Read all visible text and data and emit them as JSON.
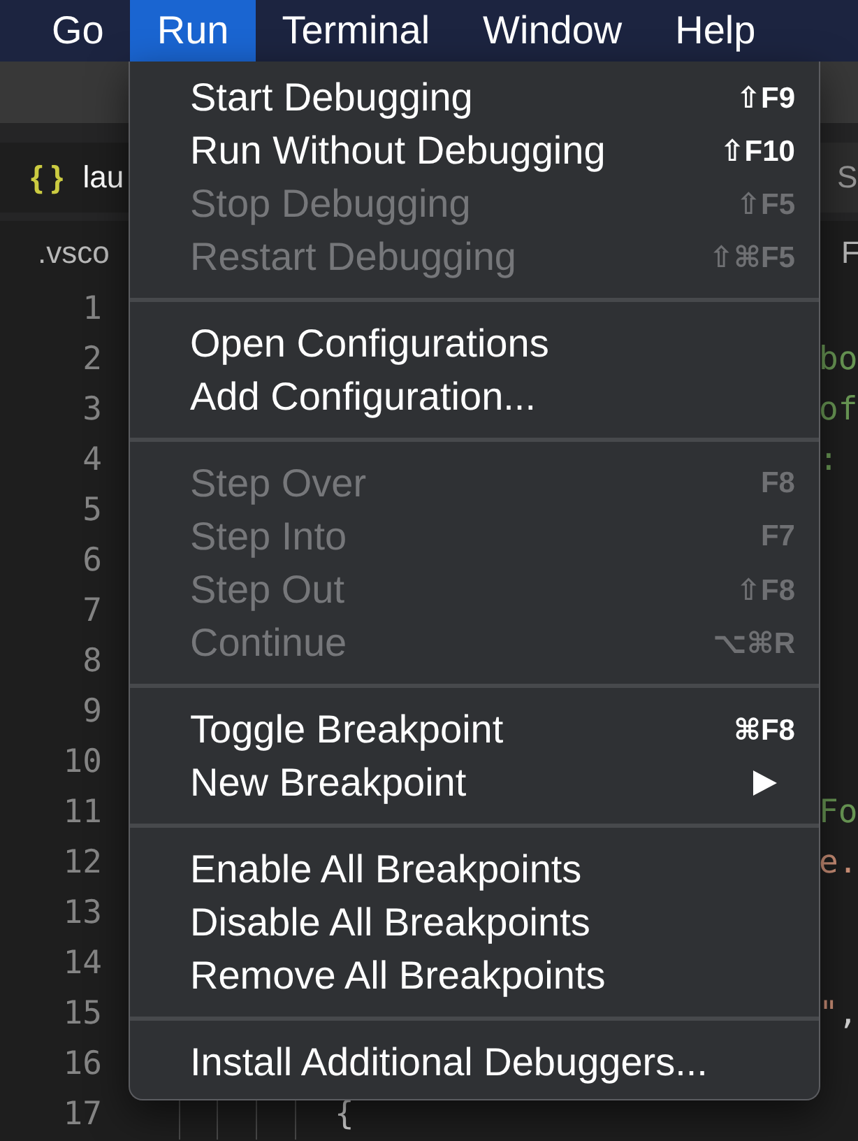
{
  "menu_bar": {
    "items": [
      {
        "label": "Go",
        "selected": false
      },
      {
        "label": "Run",
        "selected": true
      },
      {
        "label": "Terminal",
        "selected": false
      },
      {
        "label": "Window",
        "selected": false
      },
      {
        "label": "Help",
        "selected": false
      }
    ]
  },
  "run_menu": {
    "groups": [
      {
        "items": [
          {
            "label": "Start Debugging",
            "shortcut": "⇧F9",
            "disabled": false
          },
          {
            "label": "Run Without Debugging",
            "shortcut": "⇧F10",
            "disabled": false
          },
          {
            "label": "Stop Debugging",
            "shortcut": "⇧F5",
            "disabled": true
          },
          {
            "label": "Restart Debugging",
            "shortcut": "⇧⌘F5",
            "disabled": true
          }
        ]
      },
      {
        "items": [
          {
            "label": "Open Configurations",
            "disabled": false
          },
          {
            "label": "Add Configuration...",
            "disabled": false
          }
        ]
      },
      {
        "items": [
          {
            "label": "Step Over",
            "shortcut": "F8",
            "disabled": true
          },
          {
            "label": "Step Into",
            "shortcut": "F7",
            "disabled": true
          },
          {
            "label": "Step Out",
            "shortcut": "⇧F8",
            "disabled": true
          },
          {
            "label": "Continue",
            "shortcut": "⌥⌘R",
            "disabled": true
          }
        ]
      },
      {
        "items": [
          {
            "label": "Toggle Breakpoint",
            "shortcut": "⌘F8",
            "disabled": false
          },
          {
            "label": "New Breakpoint",
            "disabled": false,
            "submenu": true
          }
        ]
      },
      {
        "items": [
          {
            "label": "Enable All Breakpoints",
            "disabled": false
          },
          {
            "label": "Disable All Breakpoints",
            "disabled": false
          },
          {
            "label": "Remove All Breakpoints",
            "disabled": false
          }
        ]
      },
      {
        "items": [
          {
            "label": "Install Additional Debuggers...",
            "disabled": false
          }
        ]
      }
    ]
  },
  "editor": {
    "tabs": [
      {
        "icon": "{ }",
        "label": "lau",
        "selected": true
      }
    ],
    "split_tabs": [
      {
        "label": "S",
        "selected": false
      }
    ],
    "breadcrumb": ".vsco",
    "split_breadcrumb": "F",
    "lines": [
      {
        "number": "1"
      },
      {
        "number": "2",
        "split": [
          {
            "kind": "comment",
            "text": "bo"
          }
        ]
      },
      {
        "number": "3",
        "split": [
          {
            "kind": "comment",
            "text": "of"
          }
        ]
      },
      {
        "number": "4",
        "split": [
          {
            "kind": "comment",
            "text": ":"
          }
        ]
      },
      {
        "number": "5"
      },
      {
        "number": "6"
      },
      {
        "number": "7"
      },
      {
        "number": "8"
      },
      {
        "number": "9"
      },
      {
        "number": "10"
      },
      {
        "number": "11",
        "split": [
          {
            "kind": "comment",
            "text": "Fo"
          }
        ]
      },
      {
        "number": "12",
        "split": [
          {
            "kind": "string",
            "text": "e."
          }
        ]
      },
      {
        "number": "13"
      },
      {
        "number": "14"
      },
      {
        "number": "15",
        "split": [
          {
            "kind": "string",
            "text": "\""
          },
          {
            "kind": "plain",
            "text": ","
          }
        ]
      },
      {
        "number": "16"
      },
      {
        "number": "17",
        "code": "          {"
      }
    ]
  }
}
